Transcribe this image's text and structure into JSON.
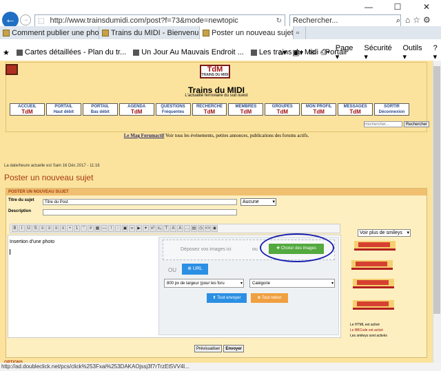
{
  "browser": {
    "window_controls": [
      "—",
      "☐",
      "✕"
    ],
    "url": "http://www.trainsdumidi.com/post?f=73&mode=newtopic",
    "search_placeholder": "Rechercher...",
    "tabs": [
      {
        "label": "Comment publier une photo sur..."
      },
      {
        "label": "Trains du MIDI - Bienvenue sur v..."
      },
      {
        "label": "Poster un nouveau sujet"
      }
    ],
    "favorites": [
      {
        "label": "Cartes détaillées - Plan du tr..."
      },
      {
        "label": "Un Jour Au Mauvais Endroit ..."
      },
      {
        "label": "Les trains du Midi - Portail"
      }
    ],
    "tools": [
      "Page ▾",
      "Sécurité ▾",
      "Outils ▾"
    ],
    "status_url": "http://ad.doubleclick.net/pcs/click%253Fxai%253DAKAOjssj3f7rTrzEt5VV4l..."
  },
  "site": {
    "logo": "TdM",
    "logo_sub": "TRAINS DU MIDI",
    "title": "Trains du MIDI",
    "tagline": "L'actualité ferroviaire du sud ouest",
    "nav": [
      {
        "top": "ACCUEIL",
        "bottom": "TdM"
      },
      {
        "top": "PORTAIL",
        "bottom": "Haut débit"
      },
      {
        "top": "PORTAIL",
        "bottom": "Bas débit"
      },
      {
        "top": "AGENDA",
        "bottom": "TdM"
      },
      {
        "top": "QUESTIONS",
        "bottom": "Fréquentes"
      },
      {
        "top": "RECHERCHE",
        "bottom": "TdM"
      },
      {
        "top": "MEMBRES",
        "bottom": "TdM"
      },
      {
        "top": "GROUPES",
        "bottom": "TdM"
      },
      {
        "top": "MON PROFIL",
        "bottom": "TdM"
      },
      {
        "top": "MESSAGES",
        "bottom": "TdM"
      },
      {
        "top": "SORTIR",
        "bottom": "Déconnexion"
      }
    ],
    "search_placeholder": "Rechercher...",
    "search_button": "Rechercher",
    "mag_link": "Le Mag Forumactif",
    "mag_text": " Voir tous les événements, petites annonces, publications des forums actifs.",
    "datetime": "La date/heure actuelle est Sam 16 Déc 2017 - 11:16"
  },
  "form": {
    "page_title": "Poster un nouveau sujet",
    "section_header": "POSTER UN NOUVEAU SUJET",
    "subject_label": "Titre du sujet",
    "subject_value": "Titre du Post",
    "prefix_select": "Aucune",
    "description_label": "Description",
    "editor_text": "Insertion d'une photo",
    "uploader": {
      "drop_text": "Déposez vos images ici",
      "or": "ou",
      "choose_button": "✚ Choisir des images",
      "url_button": "⊕ URL",
      "size_select": "800 px de largeur (pour les foru",
      "category_select": "Catégorie",
      "send_all": "⬆ Tout envoyer",
      "remove_all": "⊗ Tout retirer"
    },
    "smileys_select": "Voir plus de smileys",
    "status_lines": [
      "Le HTML est activé",
      "Le BBCode est activé",
      "Les smileys sont activés"
    ],
    "preview_button": "Prévisualiser",
    "submit_button": "Envoyer",
    "options_label": "OPTIONS"
  }
}
